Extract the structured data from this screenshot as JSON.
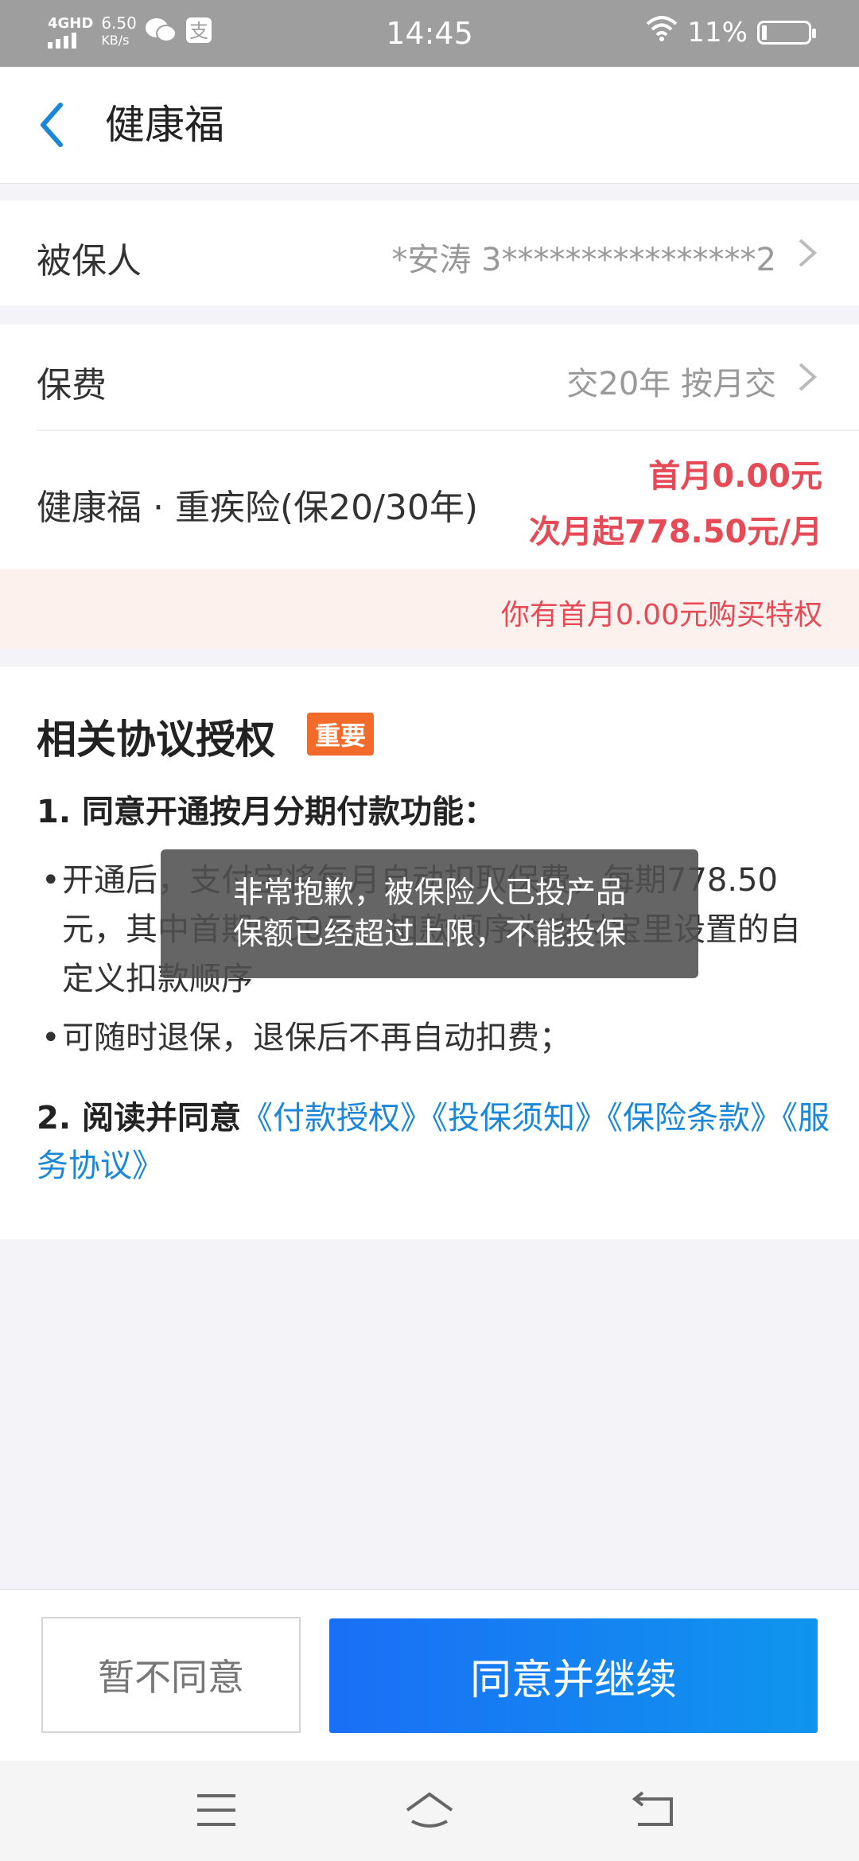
{
  "status_bar": {
    "network": "4GHD",
    "speed": "6.50",
    "speed_unit": "KB/s",
    "time": "14:45",
    "battery": "11%",
    "battery_level": 0.11
  },
  "nav": {
    "title": "健康福"
  },
  "insured": {
    "label": "被保人",
    "value": "*安涛 3****************2"
  },
  "premium": {
    "label": "保费",
    "value": "交20年 按月交"
  },
  "product": {
    "name": "健康福 · 重疾险(保20/30年)",
    "first_month": "首月0.00元",
    "next_month": "次月起778.50元/月"
  },
  "promo": {
    "text": "你有首月0.00元购买特权"
  },
  "agreement": {
    "title": "相关协议授权",
    "badge": "重要",
    "item1_title": "1. 同意开通按月分期付款功能：",
    "bullet1": "开通后，支付宝将每月自动扣取保费，每期778.50元，其中首期0.00元，扣款顺序为支付宝里设置的自定义扣款顺序",
    "bullet2": "可随时退保，退保后不再自动扣费；",
    "item2_prefix": "2. 阅读并同意",
    "links": [
      "《付款授权》",
      "《投保须知》",
      "《保险条款》",
      "《服务协议》"
    ]
  },
  "toast": {
    "line1": "非常抱歉，被保险人已投产品",
    "line2": "保额已经超过上限，不能投保"
  },
  "actions": {
    "decline": "暂不同意",
    "agree": "同意并继续"
  }
}
